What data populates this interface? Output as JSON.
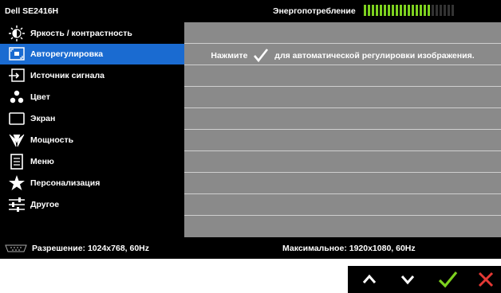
{
  "header": {
    "model": "Dell SE2416H",
    "energy_label": "Энергопотребление",
    "energy_level": 0.72
  },
  "menu": [
    {
      "name": "brightness-contrast",
      "label": "Яркость / контрастность",
      "icon": "brightness-icon"
    },
    {
      "name": "auto-adjust",
      "label": "Авторегулировка",
      "icon": "auto-adjust-icon",
      "active": true
    },
    {
      "name": "input-source",
      "label": "Источник сигнала",
      "icon": "input-source-icon"
    },
    {
      "name": "color",
      "label": "Цвет",
      "icon": "color-icon"
    },
    {
      "name": "display",
      "label": "Экран",
      "icon": "display-icon"
    },
    {
      "name": "power",
      "label": "Мощность",
      "icon": "power-icon"
    },
    {
      "name": "menu",
      "label": "Меню",
      "icon": "menu-icon"
    },
    {
      "name": "personalize",
      "label": "Персонализация",
      "icon": "star-icon"
    },
    {
      "name": "others",
      "label": "Другое",
      "icon": "others-icon"
    }
  ],
  "content": {
    "prefix": "Нажмите",
    "suffix": "для автоматической регулировки изображения."
  },
  "footer": {
    "resolution": "Разрешение:  1024x768, 60Hz",
    "maximum": "Максимальное:  1920x1080, 60Hz"
  },
  "buttons": [
    "up-icon",
    "down-icon",
    "check-icon",
    "close-icon"
  ],
  "colors": {
    "active": "#1a6bd1",
    "content_bg": "#8a8a8a",
    "energy_on": "#7dd11f",
    "check": "#7dd11f",
    "close": "#e53935"
  }
}
